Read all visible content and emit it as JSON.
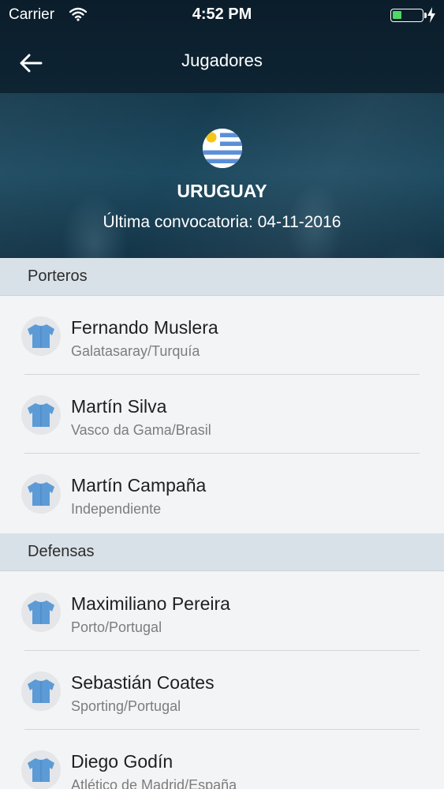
{
  "status_bar": {
    "carrier": "Carrier",
    "time": "4:52 PM",
    "battery_color": "#4cd964"
  },
  "nav": {
    "title": "Jugadores",
    "back_icon": "arrow-left-icon"
  },
  "hero": {
    "team": "URUGUAY",
    "last_call": "Última convocatoria: 04-11-2016",
    "flag_icon": "uruguay-flag-icon"
  },
  "sections": [
    {
      "label": "Porteros",
      "players": [
        {
          "name": "Fernando Muslera",
          "club": "Galatasaray/Turquía"
        },
        {
          "name": "Martín Silva",
          "club": "Vasco da Gama/Brasil"
        },
        {
          "name": "Martín Campaña",
          "club": "Independiente"
        }
      ]
    },
    {
      "label": "Defensas",
      "players": [
        {
          "name": "Maximiliano Pereira",
          "club": "Porto/Portugal"
        },
        {
          "name": "Sebastián Coates",
          "club": "Sporting/Portugal"
        },
        {
          "name": "Diego Godín",
          "club": "Atlético de Madrid/España"
        }
      ]
    }
  ],
  "colors": {
    "header_bg": "#0e2433",
    "section_bg": "#d9e1e8",
    "jersey": "#5c9bd6"
  }
}
